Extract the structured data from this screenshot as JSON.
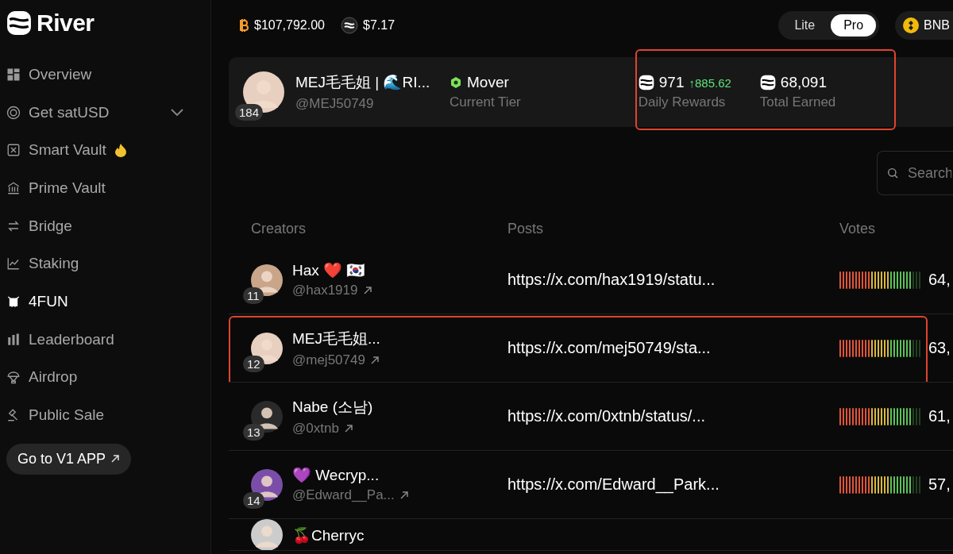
{
  "brand": "River",
  "sidebar": {
    "items": [
      {
        "label": "Overview",
        "selected": false
      },
      {
        "label": "Get satUSD",
        "selected": false,
        "expandable": true
      },
      {
        "label": "Smart Vault",
        "selected": false,
        "hot": true
      },
      {
        "label": "Prime Vault",
        "selected": false
      },
      {
        "label": "Bridge",
        "selected": false
      },
      {
        "label": "Staking",
        "selected": false
      },
      {
        "label": "4FUN",
        "selected": true
      },
      {
        "label": "Leaderboard",
        "selected": false
      },
      {
        "label": "Airdrop",
        "selected": false
      },
      {
        "label": "Public Sale",
        "selected": false
      }
    ],
    "link": "Go to V1 APP"
  },
  "tickers": [
    {
      "kind": "btc",
      "price": "$107,792.00"
    },
    {
      "kind": "river",
      "price": "$7.17"
    }
  ],
  "mode_toggle": [
    {
      "label": "Lite",
      "selected": false
    },
    {
      "label": "Pro",
      "selected": true
    }
  ],
  "network": "BNB",
  "profile": {
    "name": "MEJ毛毛姐 | 🌊RI...",
    "handle": "@MEJ50749",
    "rank": "184",
    "tier": "Mover",
    "tier_label": "Current Tier",
    "daily": "971",
    "daily_change": "↑885.62",
    "daily_label": "Daily Rewards",
    "total": "68,091",
    "total_label": "Total Earned",
    "highlighted": true
  },
  "search": {
    "placeholder": "Search"
  },
  "table": {
    "columns": [
      "Creators",
      "Posts",
      "Votes"
    ],
    "rows": [
      {
        "rank": "11",
        "name": "Hax ❤️ 🇰🇷",
        "handle": "@hax1919",
        "post": "https://x.com/hax1919/statu...",
        "votes": "64,",
        "highlighted": false
      },
      {
        "rank": "12",
        "name": "MEJ毛毛姐...",
        "handle": "@mej50749",
        "post": "https://x.com/mej50749/sta...",
        "votes": "63,",
        "highlighted": true
      },
      {
        "rank": "13",
        "name": "Nabe (소남)",
        "handle": "@0xtnb",
        "post": "https://x.com/0xtnb/status/...",
        "votes": "61,",
        "highlighted": false
      },
      {
        "rank": "14",
        "name": "💜 Wecryp...",
        "handle": "@Edward__Pa...",
        "post": "https://x.com/Edward__Park...",
        "votes": "57,",
        "highlighted": false
      },
      {
        "name": "🍒Cherryc",
        "highlighted": false
      }
    ]
  }
}
